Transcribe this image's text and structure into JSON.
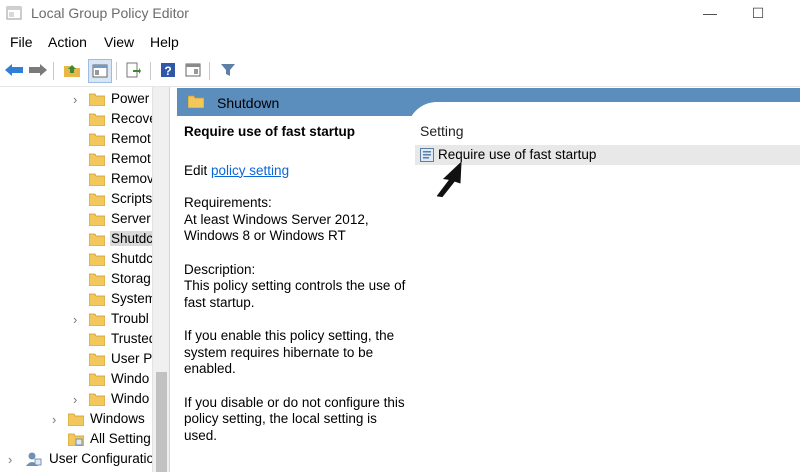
{
  "window": {
    "title": "Local Group Policy Editor",
    "minimize": "—",
    "maximize": "☐"
  },
  "menu": [
    "File",
    "Action",
    "View",
    "Help"
  ],
  "tree": {
    "items": [
      {
        "label": "Power",
        "expandable": true
      },
      {
        "label": "Recove",
        "expandable": false
      },
      {
        "label": "Remot",
        "expandable": false
      },
      {
        "label": "Remot",
        "expandable": false
      },
      {
        "label": "Remov",
        "expandable": false
      },
      {
        "label": "Scripts",
        "expandable": false
      },
      {
        "label": "Server",
        "expandable": false
      },
      {
        "label": "Shutdc",
        "expandable": false,
        "selected": true
      },
      {
        "label": "Shutdc",
        "expandable": false
      },
      {
        "label": "Storag",
        "expandable": false
      },
      {
        "label": "System",
        "expandable": false
      },
      {
        "label": "Troubl",
        "expandable": true
      },
      {
        "label": "Trusted",
        "expandable": false
      },
      {
        "label": "User Pr",
        "expandable": false
      },
      {
        "label": "Windo",
        "expandable": false
      },
      {
        "label": "Windo",
        "expandable": true
      }
    ],
    "windows_settings": "Windows ",
    "all_settings": "All Setting",
    "user_configuration": "User Configuratio"
  },
  "pane": {
    "header_title": "Shutdown",
    "policy_title": "Require use of fast startup",
    "edit_prefix": "Edit",
    "edit_link": "policy setting",
    "requirements_label": "Requirements:",
    "requirements_line1": "At least Windows Server 2012,",
    "requirements_line2": "Windows 8 or Windows RT",
    "description_label": "Description:",
    "description_line1": "This policy setting controls the use of",
    "description_line2": "fast startup.",
    "enable_line1": "If you enable this policy setting, the",
    "enable_line2": "system requires hibernate to be",
    "enable_line3": "enabled.",
    "disable_line1": "If you disable or do not configure this",
    "disable_line2": "policy setting, the local setting is",
    "disable_line3": "used."
  },
  "settings_list": {
    "column_header": "Setting",
    "row_label": "Require use of fast startup"
  },
  "colors": {
    "header_blue": "#5b8dbd",
    "link": "#0b66d6",
    "folder": "#f2c75c"
  }
}
